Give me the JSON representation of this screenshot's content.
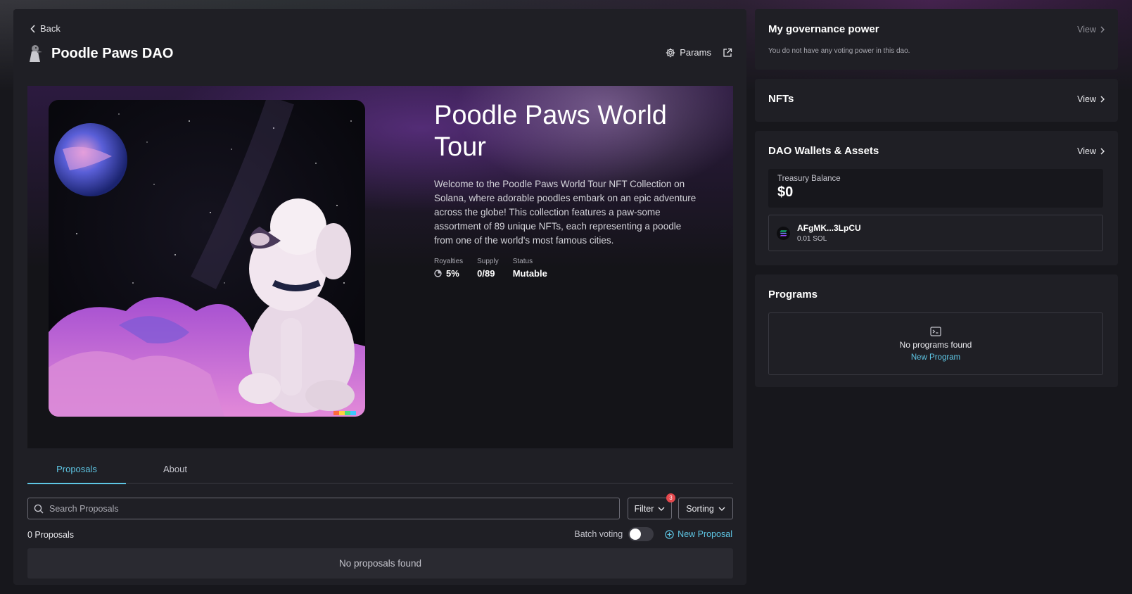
{
  "header": {
    "back_label": "Back",
    "dao_title": "Poodle Paws DAO",
    "params_label": "Params"
  },
  "hero": {
    "collection_title": "Poodle Paws World Tour",
    "description": "Welcome to the Poodle Paws World Tour NFT Collection on Solana, where adorable poodles embark on an epic adventure across the globe! This collection features a paw-some assortment of 89 unique NFTs, each representing a poodle from one of the world's most famous cities.",
    "stats": [
      {
        "label": "Royalties",
        "value": "5%"
      },
      {
        "label": "Supply",
        "value": "0/89"
      },
      {
        "label": "Status",
        "value": "Mutable"
      }
    ]
  },
  "tabs": [
    {
      "label": "Proposals",
      "active": true
    },
    {
      "label": "About",
      "active": false
    }
  ],
  "proposals": {
    "search_placeholder": "Search Proposals",
    "filter_label": "Filter",
    "filter_badge": "3",
    "sorting_label": "Sorting",
    "count_label": "0 Proposals",
    "batch_voting_label": "Batch voting",
    "batch_voting_on": false,
    "new_proposal_label": "New Proposal",
    "empty_label": "No proposals found"
  },
  "sidebar": {
    "governance": {
      "title": "My governance power",
      "view_label": "View",
      "note": "You do not have any voting power in this dao."
    },
    "nfts": {
      "title": "NFTs",
      "view_label": "View"
    },
    "wallets": {
      "title": "DAO Wallets & Assets",
      "view_label": "View",
      "treasury_label": "Treasury Balance",
      "treasury_value": "$0",
      "wallet_name": "AFgMK...3LpCU",
      "wallet_balance": "0.01 SOL"
    },
    "programs": {
      "title": "Programs",
      "empty_label": "No programs found",
      "new_program_label": "New Program"
    }
  },
  "colors": {
    "accent": "#5ec6e4",
    "background": "#17171c",
    "panel": "#1f1f25",
    "badge": "#e5484d"
  }
}
